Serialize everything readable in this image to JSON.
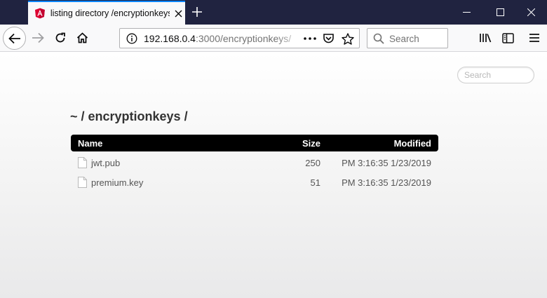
{
  "browser": {
    "tab_title": "listing directory /encryptionkeys",
    "url_host": "192.168.0.4",
    "url_rest": ":3000/encryptionkeys/",
    "search_placeholder": "Search"
  },
  "page": {
    "search_placeholder": "Search",
    "breadcrumb": "~ / encryptionkeys /",
    "columns": {
      "name": "Name",
      "size": "Size",
      "modified": "Modified"
    },
    "files": [
      {
        "name": "jwt.pub",
        "size": "250",
        "modified": "PM 3:16:35 1/23/2019"
      },
      {
        "name": "premium.key",
        "size": "51",
        "modified": "PM 3:16:35 1/23/2019"
      }
    ]
  },
  "icons": {
    "favicon": "angular-icon",
    "file": "file-icon"
  },
  "colors": {
    "titlebar": "#202340",
    "tab_accent": "#0a84ff",
    "table_header": "#000000",
    "angular_red": "#dd0031"
  }
}
